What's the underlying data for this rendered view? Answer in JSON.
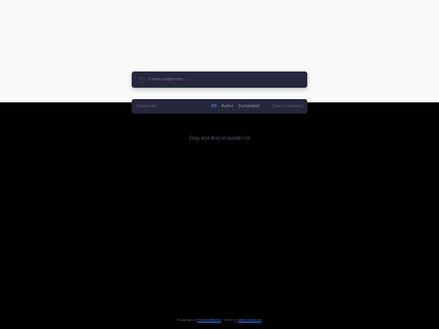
{
  "new_todo": {
    "placeholder": "Create a new todo..."
  },
  "footer": {
    "items_left": "0 items left",
    "filters": [
      "All",
      "Active",
      "Completed"
    ],
    "active_filter": "All",
    "clear_label": "Clear Completed"
  },
  "hint": "Drag and drop to reorder list",
  "attribution": {
    "prefix": "Challenge by",
    "challenge_link": "Frontend Mentor",
    "middle": ". Coded by",
    "author_link": "Maria Ushakova"
  },
  "colors": {
    "card": "#25273c",
    "accent": "#3a7cfd",
    "background_top": "#fafafa",
    "background": "#000000"
  }
}
